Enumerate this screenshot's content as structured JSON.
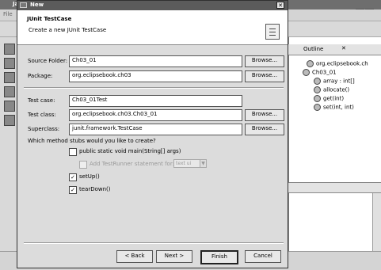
{
  "background": {
    "window_title": "Ja",
    "menu_file": "File",
    "outline": {
      "title": "Outline",
      "close": "✕",
      "items": [
        {
          "label": "org.eclipsebook.ch"
        },
        {
          "label": "Ch03_01"
        },
        {
          "label": "array : int[]"
        },
        {
          "label": "allocate()"
        },
        {
          "label": "get(int)"
        },
        {
          "label": "set(int, int)"
        }
      ]
    }
  },
  "dialog": {
    "title": "New",
    "close": "✕",
    "banner": {
      "title": "JUnit TestCase",
      "description": "Create a new JUnit TestCase"
    },
    "source_folder": {
      "label": "Source Folder:",
      "value": "Ch03_01",
      "browse": "Browse..."
    },
    "package": {
      "label": "Package:",
      "value": "org.eclipsebook.ch03",
      "browse": "Browse..."
    },
    "test_case": {
      "label": "Test case:",
      "value": "Ch03_01Test"
    },
    "test_class": {
      "label": "Test class:",
      "value": "org.eclipsebook.ch03.Ch03_01",
      "browse": "Browse..."
    },
    "superclass": {
      "label": "Superclass:",
      "value": "junit.framework.TestCase",
      "browse": "Browse..."
    },
    "stubs_question": "Which method stubs would you like to create?",
    "stubs": {
      "main": {
        "label": "public static void main(String[] args)",
        "checked": false
      },
      "testrunner": {
        "label": "Add TestRunner statement for:",
        "checked": false,
        "select_value": "text ui"
      },
      "setup": {
        "label": "setUp()",
        "checked": true
      },
      "teardown": {
        "label": "tearDown()",
        "checked": true
      }
    },
    "buttons": {
      "back": "< Back",
      "next": "Next >",
      "finish": "Finish",
      "cancel": "Cancel"
    }
  }
}
